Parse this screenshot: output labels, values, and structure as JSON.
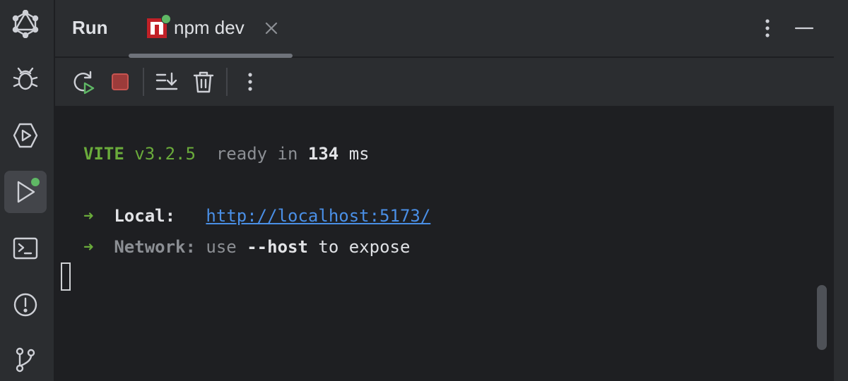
{
  "activity_bar": {
    "items": [
      {
        "icon": "graphql-icon"
      },
      {
        "icon": "bug-icon"
      },
      {
        "icon": "services-icon"
      },
      {
        "icon": "run-icon",
        "active": true
      },
      {
        "icon": "terminal-icon"
      },
      {
        "icon": "problems-icon"
      },
      {
        "icon": "git-branch-icon"
      }
    ]
  },
  "panel": {
    "title": "Run",
    "tab": {
      "label": "npm dev",
      "icon": "npm-icon"
    }
  },
  "toolbar": {
    "buttons": [
      "rerun-icon",
      "stop-icon",
      "scroll-to-end-icon",
      "clear-icon",
      "more-icon"
    ]
  },
  "console": {
    "vite_name": "VITE",
    "vite_version": "v3.2.5",
    "ready_text": "ready in",
    "ready_ms": "134",
    "ready_unit": "ms",
    "arrow": "➜",
    "local_label": "Local:",
    "local_url": "http://localhost:5173/",
    "network_label": "Network:",
    "network_use": "use",
    "network_flag": "--host",
    "network_tail": "to expose"
  },
  "colors": {
    "accent_green": "#6aab3b",
    "link_blue": "#4a8fe6",
    "status_dot": "#5fb865",
    "stop_red": "#c75450"
  }
}
